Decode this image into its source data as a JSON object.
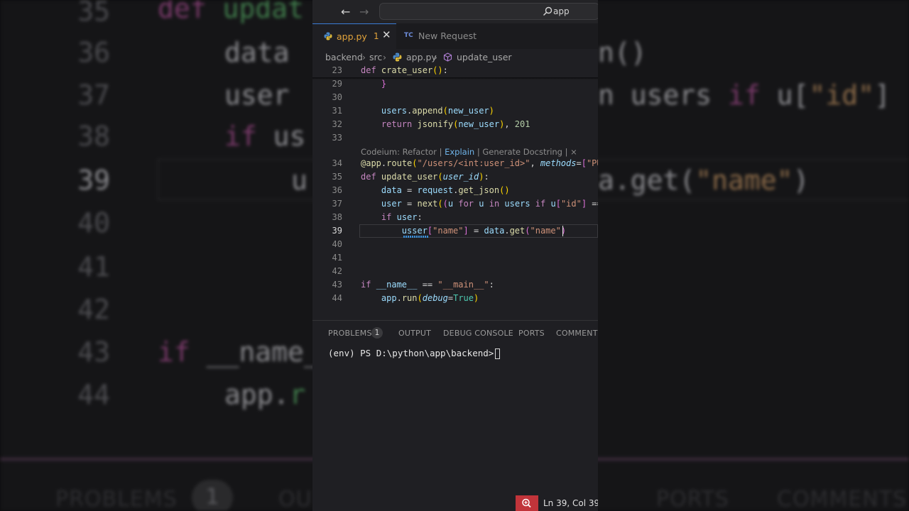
{
  "background": {
    "line_numbers": [
      "35",
      "36",
      "37",
      "38",
      "39",
      "40",
      "41",
      "42",
      "43",
      "44"
    ],
    "panel_tabs": [
      "PROBLEMS",
      "OU",
      "PORTS",
      "COMMENTS"
    ],
    "problems_count": "1"
  },
  "titlebar": {
    "search_text": "app"
  },
  "tabs": [
    {
      "label": "app.py",
      "count": "1",
      "icon": "python-icon"
    },
    {
      "label": "New Request",
      "icon": "thunder-client-icon",
      "icon_text": "TC"
    }
  ],
  "breadcrumb": [
    "backend",
    "src",
    "app.py",
    "update_user"
  ],
  "editor": {
    "sticky_line": "23",
    "lines": [
      "29",
      "30",
      "31",
      "32",
      "33",
      "34",
      "35",
      "36",
      "37",
      "38",
      "39",
      "40",
      "41",
      "42",
      "43",
      "44"
    ],
    "current_line": "39",
    "codelens": {
      "prefix": "Codeium: Refactor",
      "explain": "Explain",
      "docstring": "Generate Docstring",
      "close": "×"
    }
  },
  "panel": {
    "tabs": [
      "PROBLEMS",
      "OUTPUT",
      "DEBUG CONSOLE",
      "PORTS",
      "COMMENTS"
    ],
    "problems_count": "1",
    "terminal_prompt": "(env) PS D:\\python\\app\\backend>"
  },
  "statusbar": {
    "position": "Ln 39, Col 39"
  },
  "colors": {
    "accent": "#3a7bd5",
    "keyword": "#c586c0",
    "function": "#dcdcaa",
    "string": "#ce9178",
    "warning": "#e2a33b",
    "zoom_indicator": "#c1343a"
  }
}
